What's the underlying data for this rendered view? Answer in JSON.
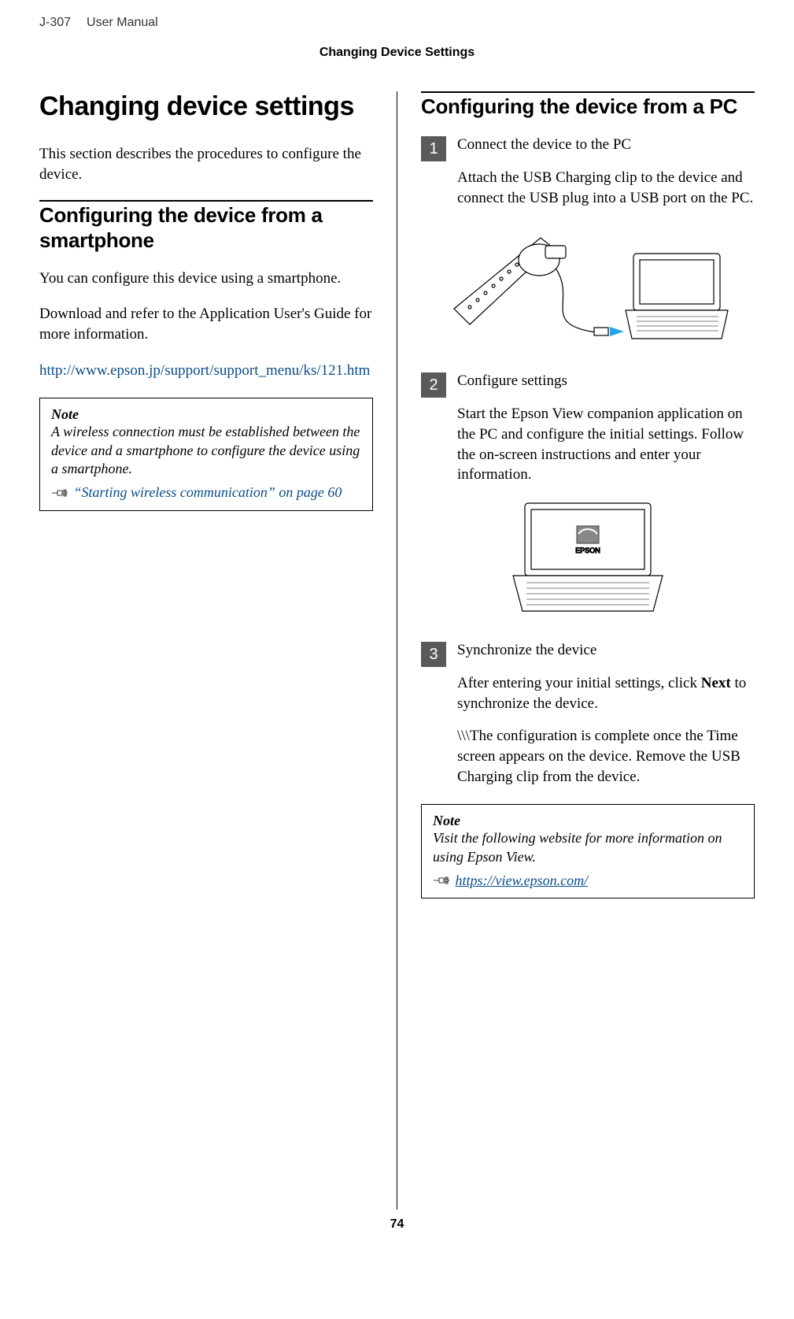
{
  "doc": {
    "model": "J-307",
    "manual_label": "User Manual",
    "section_header": "Changing Device Settings",
    "page_number": "74"
  },
  "left": {
    "title": "Changing device settings",
    "intro": "This section describes the procedures to configure the device.",
    "smartphone_heading": "Configuring the device from a smartphone",
    "sp_line1": "You can configure this device using a smartphone.",
    "sp_line2": "Download and refer to the Application User's Guide for more information.",
    "sp_url": "http://www.epson.jp/support/support_menu/ks/121.htm",
    "note_label": "Note",
    "note_body": "A wireless connection must be established between the device and a smartphone to configure the device using a smartphone.",
    "note_xref": "“Starting wireless communication” on page 60"
  },
  "right": {
    "pc_heading": "Configuring the device from a PC",
    "steps": [
      {
        "num": "1",
        "title": "Connect the device to the PC",
        "body": "Attach the USB Charging clip to the device and connect the USB plug into a USB port on the PC."
      },
      {
        "num": "2",
        "title": "Configure settings",
        "body": "Start the Epson View companion application on the PC and configure the initial settings. Follow the on-screen instructions and enter your information."
      },
      {
        "num": "3",
        "title": "Synchronize the device",
        "body1_prefix": "After entering your initial settings, click ",
        "body1_bold": "Next",
        "body1_suffix": " to synchronize the device.",
        "body2": "\\\\\\The configuration is complete once the Time screen appears on the device. Remove the USB Charging clip from the device."
      }
    ],
    "note_label": "Note",
    "note_body": "Visit the following website for more information on using Epson View.",
    "note_url": "https://view.epson.com/"
  }
}
